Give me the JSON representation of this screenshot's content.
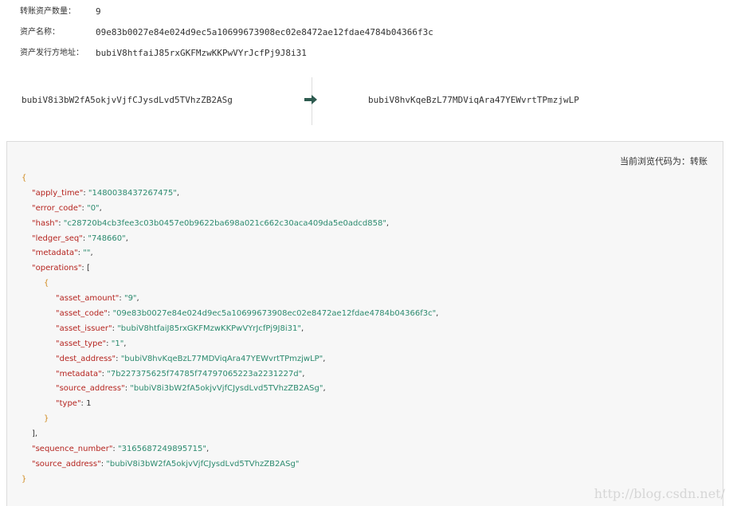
{
  "summary": {
    "amount_label": "转账资产数量：",
    "amount_value": "9",
    "name_label": "资产名称：",
    "name_value": "09e83b0027e84e024d9ec5a10699673908ec02e8472ae12fdae4784b04366f3c",
    "issuer_label": "资产发行方地址：",
    "issuer_value": "bubiV8htfaiJ85rxGKFMzwKKPwVYrJcfPj9J8i31"
  },
  "transfer": {
    "from_address": "bubiV8i3bW2fA5okjvVjfCJysdLvd5TVhzZB2ASg",
    "to_address": "bubiV8hvKqeBzL77MDViqAra47YEWvrtTPmzjwLP",
    "arrow_icon": "right-arrow-icon",
    "arrow_color": "#2e5b50"
  },
  "code_panel": {
    "mode_text": "当前浏览代码为：转账"
  },
  "json": {
    "open_brace": "{",
    "apply_time_key": "\"apply_time\"",
    "apply_time_val": "\"1480038437267475\"",
    "error_code_key": "\"error_code\"",
    "error_code_val": "\"0\"",
    "hash_key": "\"hash\"",
    "hash_val": "\"c28720b4cb3fee3c03b0457e0b9622ba698a021c662c30aca409da5e0adcd858\"",
    "ledger_seq_key": "\"ledger_seq\"",
    "ledger_seq_val": "\"748660\"",
    "metadata_key": "\"metadata\"",
    "metadata_val": "\"\"",
    "operations_key": "\"operations\"",
    "operations_open": "[",
    "op_open": "{",
    "asset_amount_key": "\"asset_amount\"",
    "asset_amount_val": "\"9\"",
    "asset_code_key": "\"asset_code\"",
    "asset_code_val": "\"09e83b0027e84e024d9ec5a10699673908ec02e8472ae12fdae4784b04366f3c\"",
    "asset_issuer_key": "\"asset_issuer\"",
    "asset_issuer_val": "\"bubiV8htfaiJ85rxGKFMzwKKPwVYrJcfPj9J8i31\"",
    "asset_type_key": "\"asset_type\"",
    "asset_type_val": "\"1\"",
    "dest_address_key": "\"dest_address\"",
    "dest_address_val": "\"bubiV8hvKqeBzL77MDViqAra47YEWvrtTPmzjwLP\"",
    "op_metadata_key": "\"metadata\"",
    "op_metadata_val": "\"7b227375625f74785f74797065223a2231227d\"",
    "op_source_address_key": "\"source_address\"",
    "op_source_address_val": "\"bubiV8i3bW2fA5okjvVjfCJysdLvd5TVhzZB2ASg\"",
    "type_key": "\"type\"",
    "type_val": "1",
    "op_close": "}",
    "operations_close": "],",
    "sequence_number_key": "\"sequence_number\"",
    "sequence_number_val": "\"3165687249895715\"",
    "source_address_key": "\"source_address\"",
    "source_address_val": "\"bubiV8i3bW2fA5okjvVjfCJysdLvd5TVhzZB2ASg\"",
    "close_brace": "}"
  },
  "watermark": "http://blog.csdn.net/"
}
